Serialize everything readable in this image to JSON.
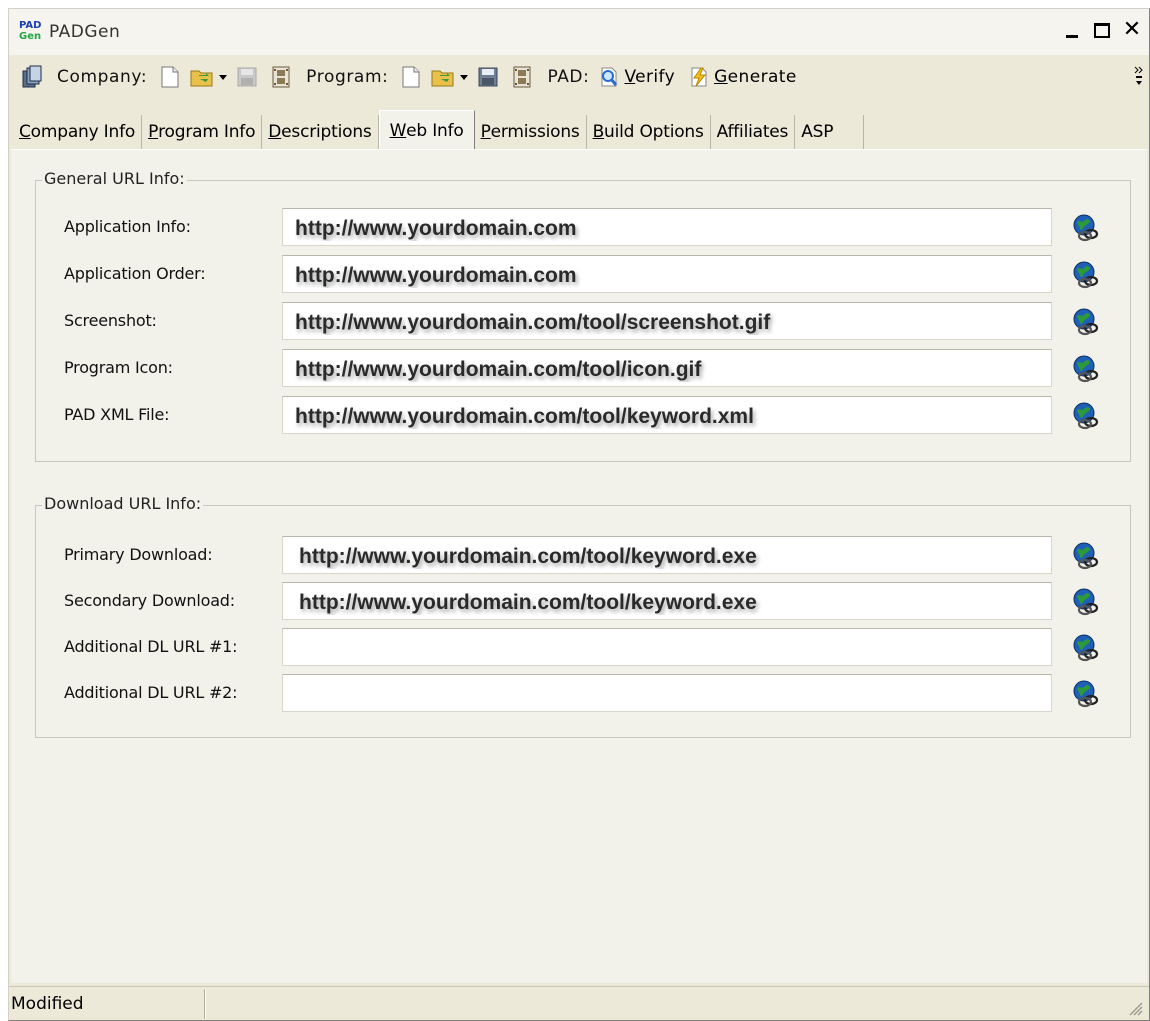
{
  "window": {
    "title": "PADGen",
    "logo_line1": "PAD",
    "logo_line2": "Gen"
  },
  "toolbar": {
    "company_label": "Company:",
    "program_label": "Program:",
    "pad_label": "PAD:",
    "verify_prefix": "",
    "verify_underlined": "V",
    "verify_rest": "erify",
    "generate_underlined": "G",
    "generate_rest": "enerate"
  },
  "tabs": [
    {
      "u": "C",
      "rest": "ompany Info"
    },
    {
      "u": "P",
      "rest": "rogram Info"
    },
    {
      "u": "D",
      "rest": "escriptions"
    },
    {
      "u": "W",
      "rest": "eb Info"
    },
    {
      "u": "P",
      "rest": "ermissions"
    },
    {
      "u": "B",
      "rest": "uild Options"
    },
    {
      "u": "",
      "rest": "Affiliates"
    },
    {
      "u": "",
      "rest": "ASP"
    }
  ],
  "general": {
    "title": "General URL Info:",
    "rows": [
      {
        "label": "Application Info:",
        "value": "http://www.yourdomain.com"
      },
      {
        "label": "Application Order:",
        "value": "http://www.yourdomain.com"
      },
      {
        "label": "Screenshot:",
        "value": "http://www.yourdomain.com/tool/screenshot.gif"
      },
      {
        "label": "Program Icon:",
        "value": "http://www.yourdomain.com/tool/icon.gif"
      },
      {
        "label": "PAD XML File:",
        "value": "http://www.yourdomain.com/tool/keyword.xml"
      }
    ]
  },
  "download": {
    "title": "Download URL Info:",
    "rows": [
      {
        "label": "Primary Download:",
        "value": "http://www.yourdomain.com/tool/keyword.exe"
      },
      {
        "label": "Secondary Download:",
        "value": "http://www.yourdomain.com/tool/keyword.exe"
      },
      {
        "label": "Additional DL URL #1:",
        "value": ""
      },
      {
        "label": "Additional DL URL #2:",
        "value": ""
      }
    ]
  },
  "status": {
    "text": "Modified"
  },
  "colors": {
    "window_bg": "#ece9d8",
    "panel_bg": "#f2f1ea",
    "logo_blue": "#1a3fae",
    "logo_green": "#21a844"
  },
  "icons": [
    "app-logo-icon",
    "padgen-app-icon",
    "new-file-icon",
    "open-folder-icon",
    "save-icon",
    "film-icon",
    "verify-magnifier-icon",
    "generate-lightning-icon",
    "globe-link-icon",
    "size-grip-icon"
  ]
}
